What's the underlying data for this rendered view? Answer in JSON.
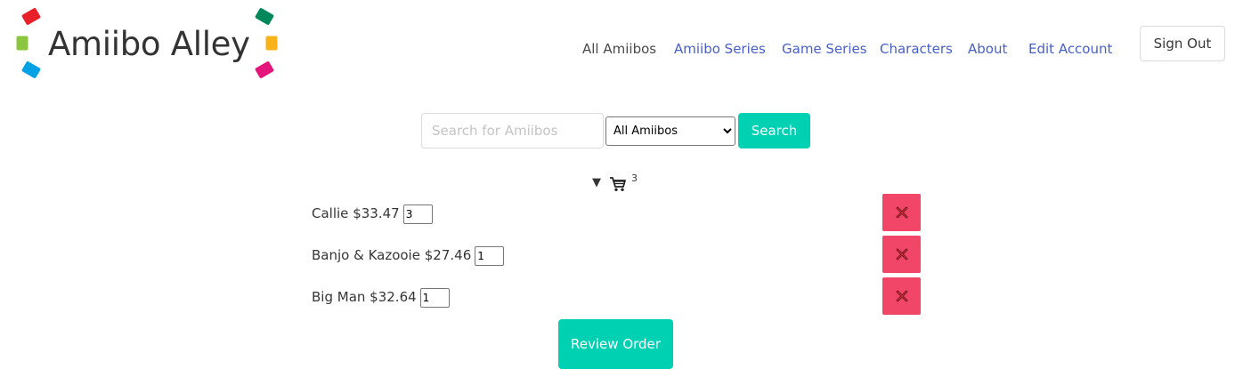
{
  "brand": {
    "name": "Amiibo Alley",
    "tile_colors": [
      "#e8202a",
      "#8cc63f",
      "#00a2e5",
      "#00875a",
      "#f8b21a",
      "#e4147c"
    ]
  },
  "nav": {
    "items": [
      {
        "label": "All Amiibos",
        "active": true
      },
      {
        "label": "Amiibo Series",
        "active": false
      },
      {
        "label": "Game Series",
        "active": false
      },
      {
        "label": "Characters",
        "active": false
      },
      {
        "label": "About",
        "active": false
      },
      {
        "label": "Edit Account",
        "active": false
      }
    ],
    "sign_out": "Sign Out",
    "link_color": "#485fc7",
    "active_color": "#4a4a4a"
  },
  "search": {
    "placeholder": "Search for Amiibos",
    "value": "",
    "filter_selected": "All Amiibos",
    "button": "Search"
  },
  "cart": {
    "toggle": "▼",
    "icon": "cart-icon",
    "count": "3",
    "items": [
      {
        "name": "Callie",
        "price": "$33.47",
        "qty": "3"
      },
      {
        "name": "Banjo & Kazooie",
        "price": "$27.46",
        "qty": "1"
      },
      {
        "name": "Big Man",
        "price": "$32.64",
        "qty": "1"
      }
    ],
    "remove_icon": "close-icon",
    "review_button": "Review Order"
  },
  "colors": {
    "accent": "#00d1b2",
    "danger": "#f14668"
  }
}
